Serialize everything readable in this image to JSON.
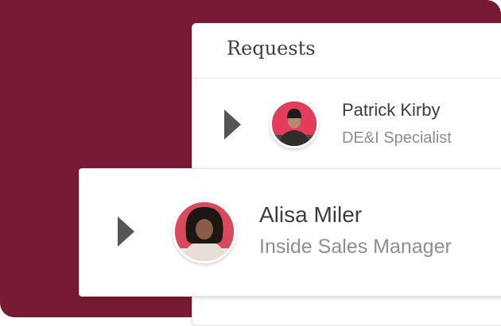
{
  "requests": {
    "title": "Requests",
    "items": [
      {
        "name": "Patrick Kirby",
        "role": "DE&I Specialist",
        "avatar_bg": "#e23d5b"
      },
      {
        "name": "Alisa Miler",
        "role": "Inside Sales Manager",
        "avatar_bg": "#d84a5e"
      }
    ]
  },
  "colors": {
    "background": "#781a33",
    "arrow": "#555555",
    "name_text": "#3c3c3c",
    "role_text": "#8e8e8e"
  },
  "icons": {
    "expand": "caret-right-icon"
  }
}
